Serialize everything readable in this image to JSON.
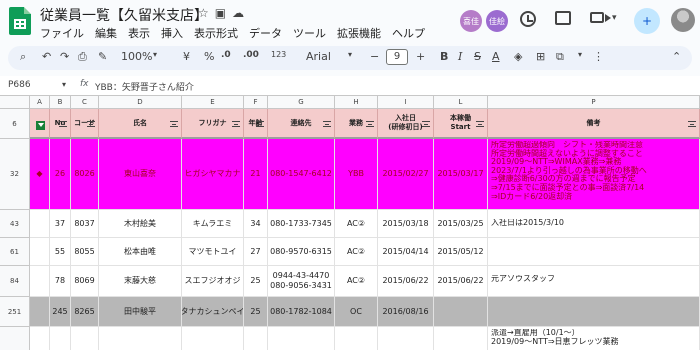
{
  "app": {
    "title": "従業員一覧【久留米支店】",
    "menus": [
      "ファイル",
      "編集",
      "表示",
      "挿入",
      "表示形式",
      "データ",
      "ツール",
      "拡張機能",
      "ヘルプ"
    ],
    "collaborators": [
      {
        "label": "喜佳",
        "color": "#b57cc8"
      },
      {
        "label": "佳絵",
        "color": "#9b6bd0"
      }
    ],
    "share_icon": "person-add-icon"
  },
  "toolbar": {
    "zoom": "100%",
    "currency": "¥",
    "percent": "%",
    "decrease_decimals": ".0",
    "increase_decimals": ".00",
    "format_number": "123",
    "font": "Arial",
    "font_size": "9"
  },
  "formula": {
    "cell_ref": "P686",
    "content": "YBB：矢野晋子さん紹介"
  },
  "columns": [
    "A",
    "B",
    "C",
    "D",
    "E",
    "F",
    "G",
    "H",
    "I",
    "L",
    "P"
  ],
  "header_row": {
    "row_number": "6",
    "cells": [
      "",
      "No",
      "コード",
      "氏名",
      "フリガナ",
      "年齢",
      "連絡先",
      "業務",
      "入社日\n(研修初日)",
      "本稼働\nStart",
      "備考"
    ]
  },
  "rows": [
    {
      "row_number": "32",
      "cells": [
        "◆",
        "26",
        "8026",
        "東山喜奈",
        "ヒガシヤマカナ",
        "21",
        "080-1547-6412",
        "YBB",
        "2015/02/27",
        "2015/03/17",
        "所定労働超過傾向　シフト・残業時間注意\n所定労働時間超えないように調整すること\n2019/09～NTT⇒WIMAX業務⇒兼務\n2023/7/1より引っ越しの為事業所の移動へ\n⇒健康診断6/30の方の週までに報告予定\n⇒7/15までに面談予定との事⇒面談済7/14\n⇒IDカード6/20返却済"
      ],
      "bg": "#ff00ff"
    },
    {
      "row_number": "43",
      "cells": [
        "",
        "37",
        "8037",
        "木村絵美",
        "キムラエミ",
        "34",
        "080-1733-7345",
        "AC②",
        "2015/03/18",
        "2015/03/25",
        "入社日は2015/3/10"
      ],
      "bg": "#ffffff"
    },
    {
      "row_number": "61",
      "cells": [
        "",
        "55",
        "8055",
        "松本由唯",
        "マツモトユイ",
        "27",
        "080-9570-6315",
        "AC②",
        "2015/04/14",
        "2015/05/12",
        ""
      ],
      "bg": "#ffffff"
    },
    {
      "row_number": "84",
      "cells": [
        "",
        "78",
        "8069",
        "末藤大慈",
        "スエフジオオジ",
        "25",
        "0944-43-4470\n080-9056-3431",
        "AC②",
        "2015/06/22",
        "2015/06/22",
        "元アソウスタッフ"
      ],
      "bg": "#ffffff"
    },
    {
      "row_number": "251",
      "cells": [
        "",
        "245",
        "8265",
        "田中駿平",
        "タナカシュンペイ",
        "25",
        "080-1782-1084",
        "OC",
        "2016/08/16",
        "",
        ""
      ],
      "bg": "#b7b7b7"
    },
    {
      "row_number": "",
      "cells": [
        "",
        "",
        "",
        "",
        "",
        "",
        "",
        "",
        "",
        "",
        "派遣→直雇用（10/1～）\n2019/09～NTT⇒日恵フレッツ業務"
      ],
      "bg": "#ffffff"
    }
  ]
}
